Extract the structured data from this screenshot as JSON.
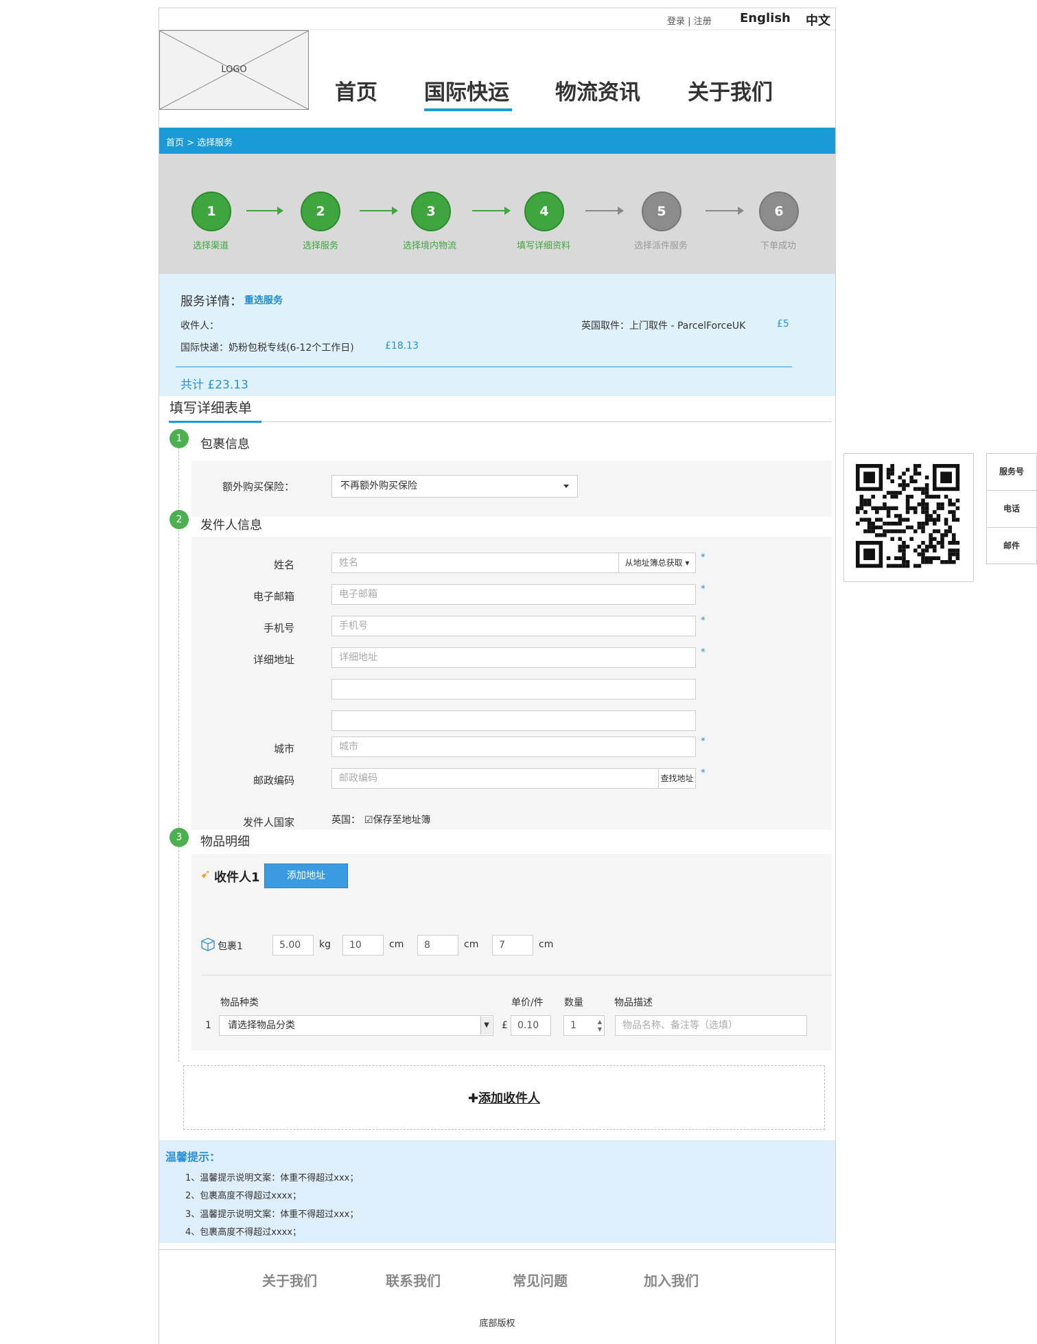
{
  "header": {
    "login": "登录",
    "separator": "|",
    "register": "注册",
    "lang_en": "English",
    "lang_zh": "中文",
    "logo": "LOGO"
  },
  "nav": {
    "items": [
      "首页",
      "国际快运",
      "物流资讯",
      "关于我们"
    ],
    "active_index": 1
  },
  "breadcrumb": "首页 > 选择服务",
  "steps": [
    {
      "num": "1",
      "label": "选择渠道",
      "state": "done"
    },
    {
      "num": "2",
      "label": "选择服务",
      "state": "done"
    },
    {
      "num": "3",
      "label": "选择境内物流",
      "state": "done"
    },
    {
      "num": "4",
      "label": "填写详细资料",
      "state": "done"
    },
    {
      "num": "5",
      "label": "选择派件服务",
      "state": "todo"
    },
    {
      "num": "6",
      "label": "下单成功",
      "state": "todo"
    }
  ],
  "service": {
    "title": "服务详情：",
    "reselect": "重选服务",
    "recipient_label": "收件人：",
    "uk_pickup": "英国取件：上门取件 - ParcelForceUK",
    "uk_pickup_price": "£5",
    "express_line": "国际快递：奶粉包税专线(6-12个工作日)",
    "express_price": "£18.13",
    "total": "共计 £23.13"
  },
  "form": {
    "title": "填写详细表单",
    "sections": {
      "parcel": {
        "num": "1",
        "title": "包裹信息"
      },
      "sender": {
        "num": "2",
        "title": "发件人信息"
      },
      "items": {
        "num": "3",
        "title": "物品明细"
      }
    },
    "insurance_label": "额外购买保险：",
    "insurance_value": "不再额外购买保险",
    "name_label": "姓名",
    "name_placeholder": "姓名",
    "address_book": "从地址簿总获取",
    "email_label": "电子邮箱",
    "email_placeholder": "电子邮箱",
    "phone_label": "手机号",
    "phone_placeholder": "手机号",
    "address_label": "详细地址",
    "address_placeholder": "详细地址",
    "city_label": "城市",
    "city_placeholder": "城市",
    "postcode_label": "邮政编码",
    "postcode_placeholder": "邮政编码",
    "find_address": "查找地址",
    "country_label": "发件人国家",
    "country_value": "英国：",
    "save_to_book": "保存至地址簿",
    "required": "*"
  },
  "recipient": {
    "title": "收件人1",
    "add_address": "添加地址",
    "parcel_label": "包裹1",
    "weight": "5.00",
    "weight_unit": "kg",
    "length": "10",
    "width": "8",
    "height": "7",
    "dim_unit": "cm",
    "col_category": "物品种类",
    "col_price": "单价/件",
    "col_qty": "数量",
    "col_desc": "物品描述",
    "row_num": "1",
    "category_placeholder": "请选择物品分类",
    "currency": "£",
    "price": "0.10",
    "qty": "1",
    "desc_placeholder": "物品名称、备注等（选填）"
  },
  "add_recipient": "添加收件人",
  "tips": {
    "title": "温馨提示：",
    "items": [
      "1、温馨提示说明文案：体重不得超过xxx；",
      "2、包裹高度不得超过xxxx；",
      "3、温馨提示说明文案：体重不得超过xxx；",
      "4、包裹高度不得超过xxxx；"
    ]
  },
  "footer": {
    "links": [
      "关于我们",
      "联系我们",
      "常见问题",
      "加入我们"
    ],
    "copyright": "底部版权"
  },
  "side": {
    "buttons": [
      "服务号",
      "电话",
      "邮件"
    ]
  },
  "colors": {
    "accent": "#1a9ad6",
    "step_done": "#3fa63f",
    "step_todo": "#8c8c8c",
    "service_bg": "#dff1fb"
  }
}
